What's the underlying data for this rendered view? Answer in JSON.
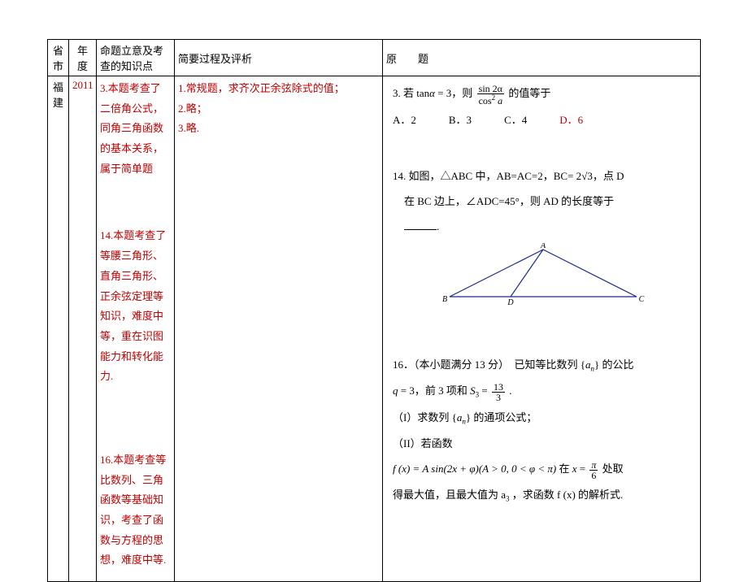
{
  "header": {
    "province": "省市",
    "year": "年度",
    "topic": "命题立意及考查的知识点",
    "analysis": "简要过程及评析",
    "problem_head": "原　　题"
  },
  "row": {
    "province": "福建",
    "year": "2011",
    "topics": {
      "t3": "3.本题考查了二倍角公式，同角三角函数的基本关系，属于简单题",
      "t14": "14.本题考查了等腰三角形、直角三角形、正余弦定理等知识，难度中等，重在识图能力和转化能力.",
      "t16": "16.本题考查等比数列、三角函数等基础知识，考查了函数与方程的思想，难度中等."
    },
    "analysis": {
      "a1": "1.常规题，求齐次正余弦除式的值；",
      "a2": "2.略；",
      "a3": "3.略."
    },
    "problem3": {
      "stem_a": "3.  若 tan",
      "alpha": "α",
      "stem_b": " = 3，则 ",
      "frac_num": "sin 2α",
      "frac_den_a": "cos",
      "frac_den_sup": "2",
      "frac_den_b": " a",
      "stem_c": " 的值等于",
      "choice_a": "A．2",
      "choice_b": "B．3",
      "choice_c": "C．4",
      "choice_d": "D．6"
    },
    "problem14": {
      "line1_a": "14.  如图，△ABC 中，AB=AC=2，BC= 2",
      "sqrt3": "√3",
      "line1_b": "，点 D",
      "line2": "在 BC 边上，∠ADC=45°，则 AD 的长度等于",
      "label_A": "A",
      "label_B": "B",
      "label_C": "C",
      "label_D": "D"
    },
    "problem16": {
      "head_a": "16．（本小题满分 13 分）　已知等比数列 {",
      "an": "a",
      "an_sub": "n",
      "head_b": "} 的公比",
      "line2_a": "q = 3，前 3 项和 S",
      "s_sub": "3",
      "line2_b": " = ",
      "frac_num": "13",
      "frac_den": "3",
      "line2_c": " .",
      "part1": "（I）求数列 {",
      "part1_b": "} 的通项公式；",
      "part2": "（II）若函数",
      "fx_a": "f (x) = A sin(2x + φ)(A > 0, 0 < φ < π) 在 x = ",
      "pi_num": "π",
      "pi_den": "6",
      "fx_b": " 处取",
      "line_last_a": "得最大值，且最大值为 a",
      "a3_sub": "3",
      "line_last_b": " ，求函数 f (x) 的解析式."
    }
  }
}
